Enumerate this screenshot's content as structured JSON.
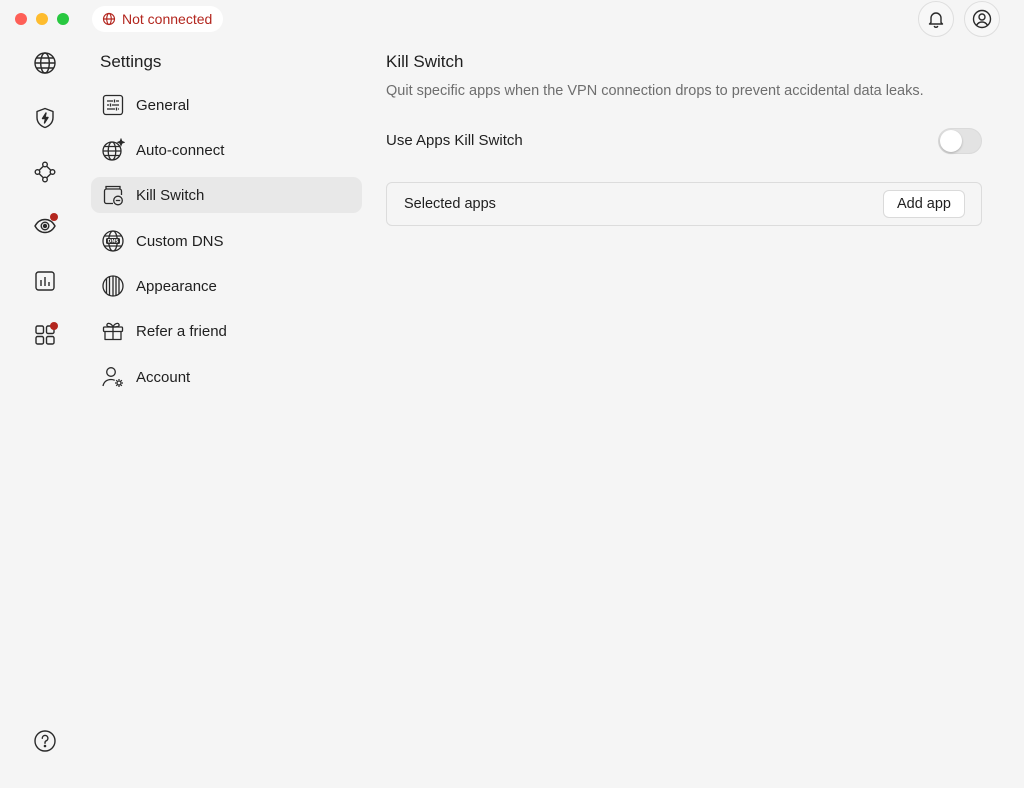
{
  "titlebar": {
    "status": "Not connected"
  },
  "rail": {
    "icons": [
      "globe-icon",
      "shield-bolt-icon",
      "mesh-network-icon",
      "eye-target-icon",
      "stats-icon",
      "apps-grid-icon",
      "help-icon"
    ]
  },
  "settings": {
    "title": "Settings",
    "items": [
      {
        "label": "General",
        "icon": "sliders-icon"
      },
      {
        "label": "Auto-connect",
        "icon": "globe-sparkle-icon"
      },
      {
        "label": "Kill Switch",
        "icon": "kill-switch-icon"
      },
      {
        "label": "Custom DNS",
        "icon": "dns-globe-icon"
      },
      {
        "label": "Appearance",
        "icon": "appearance-icon"
      },
      {
        "label": "Refer a friend",
        "icon": "gift-icon"
      },
      {
        "label": "Account",
        "icon": "account-gear-icon"
      }
    ]
  },
  "main": {
    "title": "Kill Switch",
    "description": "Quit specific apps when the VPN connection drops to prevent accidental data leaks.",
    "toggle_label": "Use Apps Kill Switch",
    "toggle_on": false,
    "selected_apps_label": "Selected apps",
    "add_app_label": "Add app"
  },
  "colors": {
    "alert": "#b3261e",
    "background": "#f5f5f5"
  }
}
